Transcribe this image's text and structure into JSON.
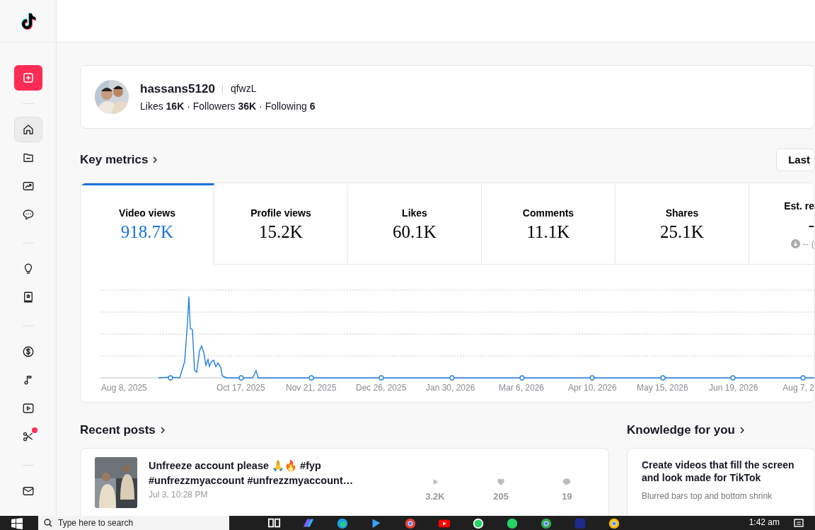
{
  "sidebar": {
    "groups": [
      {
        "items": [
          {
            "selected": true,
            "dot": false
          },
          {
            "selected": false,
            "dot": false
          },
          {
            "selected": false,
            "dot": false
          },
          {
            "selected": false,
            "dot": false
          }
        ]
      },
      {
        "items": [
          {
            "selected": false,
            "dot": false
          },
          {
            "selected": false,
            "dot": false
          }
        ]
      },
      {
        "items": [
          {
            "selected": false,
            "dot": false
          },
          {
            "selected": false,
            "dot": false
          },
          {
            "selected": false,
            "dot": false
          },
          {
            "selected": false,
            "dot": true
          }
        ]
      },
      {
        "items": [
          {
            "selected": false,
            "dot": false
          }
        ]
      }
    ]
  },
  "profile": {
    "username": "hassans5120",
    "handle": "qfwzL",
    "stats": "Likes **16K** · Followers **36K** · Following **6**"
  },
  "key_metrics": {
    "title": "Key metrics",
    "date_button": "Last",
    "metrics": [
      {
        "label": "Video views",
        "value": "918.7K",
        "selected": true
      },
      {
        "label": "Profile views",
        "value": "15.2K",
        "selected": false
      },
      {
        "label": "Likes",
        "value": "60.1K",
        "selected": false
      },
      {
        "label": "Comments",
        "value": "11.1K",
        "selected": false
      },
      {
        "label": "Shares",
        "value": "25.1K",
        "selected": false
      },
      {
        "label": "Est. re",
        "value": "-",
        "change": "-- (",
        "selected": false
      }
    ],
    "x_labels": [
      "Aug 8, 2025",
      "Oct 17, 2025",
      "Nov 21, 2025",
      "Dec 26, 2025",
      "Jan 30, 2026",
      "Mar 6, 2026",
      "Apr 10, 2026",
      "May 15, 2026",
      "Jun 19, 2026",
      "Aug 7, 2"
    ]
  },
  "recent_posts": {
    "title": "Recent posts",
    "posts": [
      {
        "title": "Unfreeze account please 🙏🔥 #fyp #unfrezzmyaccount #unfrezzmyaccount…",
        "date": "Jul 3, 10:28 PM",
        "views": "3.2K",
        "likes": "205",
        "comments": "19"
      }
    ]
  },
  "knowledge": {
    "title": "Knowledge for you",
    "cards": [
      {
        "title": "Create videos that fill the screen and look made for TikTok",
        "text": "Blurred bars top and bottom shrink"
      }
    ]
  },
  "taskbar": {
    "search_placeholder": "Type here to search",
    "time": "1:42 am"
  }
}
